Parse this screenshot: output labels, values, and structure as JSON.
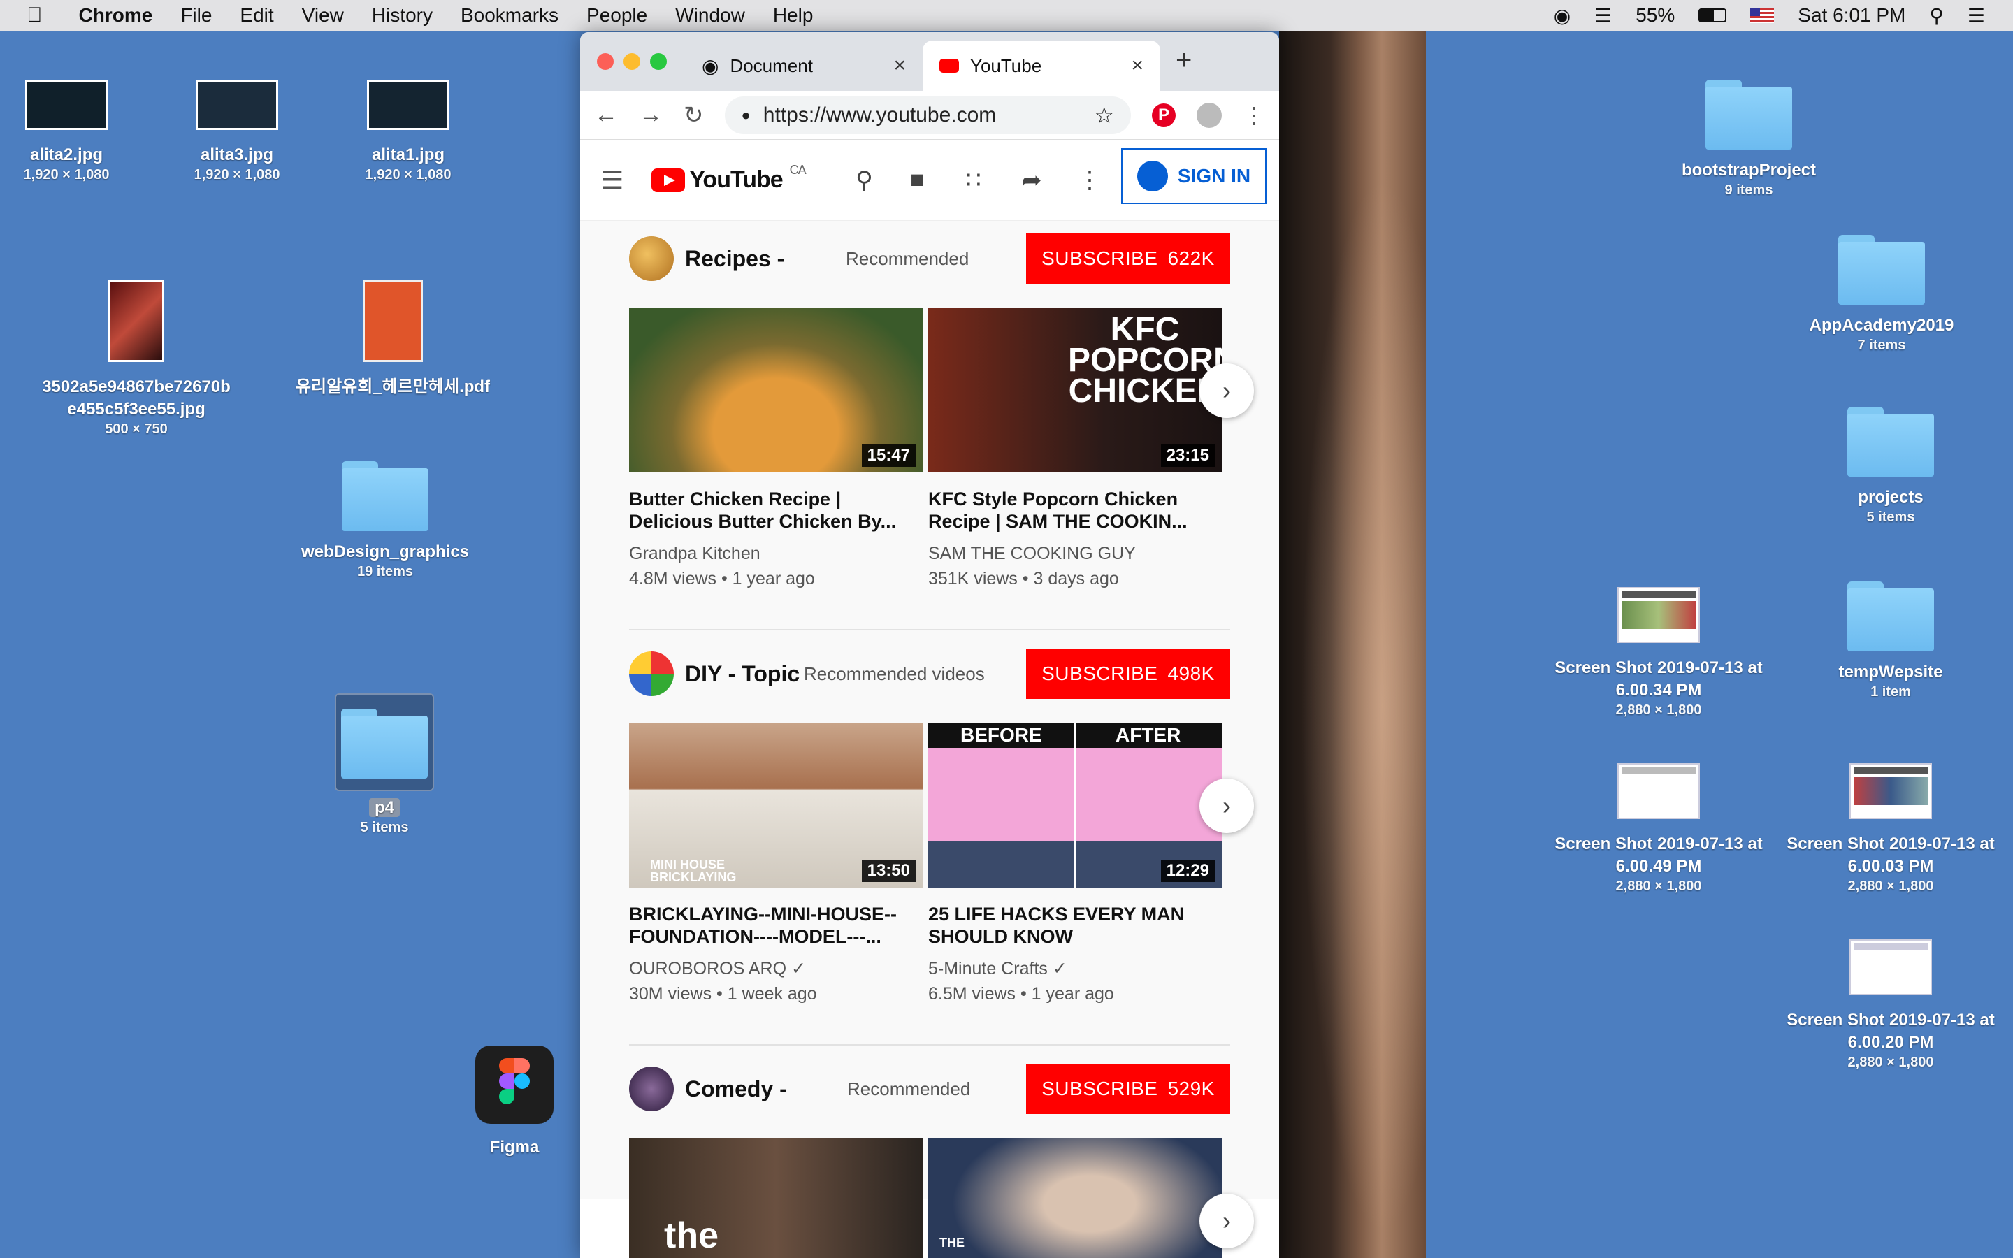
{
  "menubar": {
    "app": "Chrome",
    "items": [
      "File",
      "Edit",
      "View",
      "History",
      "Bookmarks",
      "People",
      "Window",
      "Help"
    ],
    "battery": "55%",
    "clock": "Sat 6:01 PM"
  },
  "desktop_left": [
    {
      "name": "alita2.jpg",
      "sub": "1,920 × 1,080"
    },
    {
      "name": "alita3.jpg",
      "sub": "1,920 × 1,080"
    },
    {
      "name": "alita1.jpg",
      "sub": "1,920 × 1,080"
    },
    {
      "name": "3502a5e94867be72670b e455c5f3ee55.jpg",
      "sub": "500 × 750"
    },
    {
      "name": "유리알유희_헤르만헤세.pdf",
      "sub": ""
    },
    {
      "name": "webDesign_graphics",
      "sub": "19 items"
    },
    {
      "name": "p4",
      "sub": "5 items"
    },
    {
      "name": "Figma",
      "sub": ""
    }
  ],
  "desktop_right": [
    {
      "name": "bootstrapProject",
      "sub": "9 items"
    },
    {
      "name": "AppAcademy2019",
      "sub": "7 items"
    },
    {
      "name": "projects",
      "sub": "5 items"
    },
    {
      "name": "Screen Shot 2019-07-13 at 6.00.34 PM",
      "sub": "2,880 × 1,800"
    },
    {
      "name": "tempWepsite",
      "sub": "1 item"
    },
    {
      "name": "Screen Shot 2019-07-13 at 6.00.49 PM",
      "sub": "2,880 × 1,800"
    },
    {
      "name": "Screen Shot 2019-07-13 at 6.00.03 PM",
      "sub": "2,880 × 1,800"
    },
    {
      "name": "Screen Shot 2019-07-13 at 6.00.20 PM",
      "sub": "2,880 × 1,800"
    }
  ],
  "browser": {
    "tabs": [
      {
        "label": "Document"
      },
      {
        "label": "YouTube"
      }
    ],
    "url": "https://www.youtube.com",
    "yt": {
      "logo": "YouTube",
      "region": "CA",
      "signin": "SIGN IN"
    },
    "shelves": [
      {
        "channel": "Recipes -",
        "sub": "Recommended",
        "subscribe": "SUBSCRIBE",
        "count": "622K",
        "videos": [
          {
            "title": "Butter Chicken Recipe | Delicious Butter Chicken By...",
            "channel": "Grandpa Kitchen",
            "meta": "4.8M views • 1 year ago",
            "duration": "15:47"
          },
          {
            "title": "KFC Style Popcorn Chicken Recipe | SAM THE COOKIN...",
            "channel": "SAM THE COOKING GUY",
            "meta": "351K views • 3 days ago",
            "duration": "23:15",
            "thumb_text": "KFC POPCORN CHICKEN"
          }
        ]
      },
      {
        "channel": "DIY - Topic",
        "sub": "Recommended videos",
        "subscribe": "SUBSCRIBE",
        "count": "498K",
        "videos": [
          {
            "title": "BRICKLAYING--MINI-HOUSE--FOUNDATION----MODEL---...",
            "channel": "OUROBOROS ARQ ✓",
            "meta": "30M views • 1 week ago",
            "duration": "13:50",
            "thumb_text": "MINI HOUSE BRICKLAYING"
          },
          {
            "title": "25 LIFE HACKS EVERY MAN SHOULD KNOW",
            "channel": "5-Minute Crafts ✓",
            "meta": "6.5M views • 1 year ago",
            "duration": "12:29",
            "thumb_before": "BEFORE",
            "thumb_after": "AFTER"
          }
        ]
      },
      {
        "channel": "Comedy -",
        "sub": "Recommended",
        "subscribe": "SUBSCRIBE",
        "count": "529K",
        "videos": [
          {
            "thumb_text": "the"
          },
          {
            "thumb_text": "THE"
          }
        ]
      }
    ]
  },
  "colors": {
    "desktop": "#4c7ec0",
    "yt_red": "#ff0000",
    "signin_blue": "#065fd4"
  }
}
